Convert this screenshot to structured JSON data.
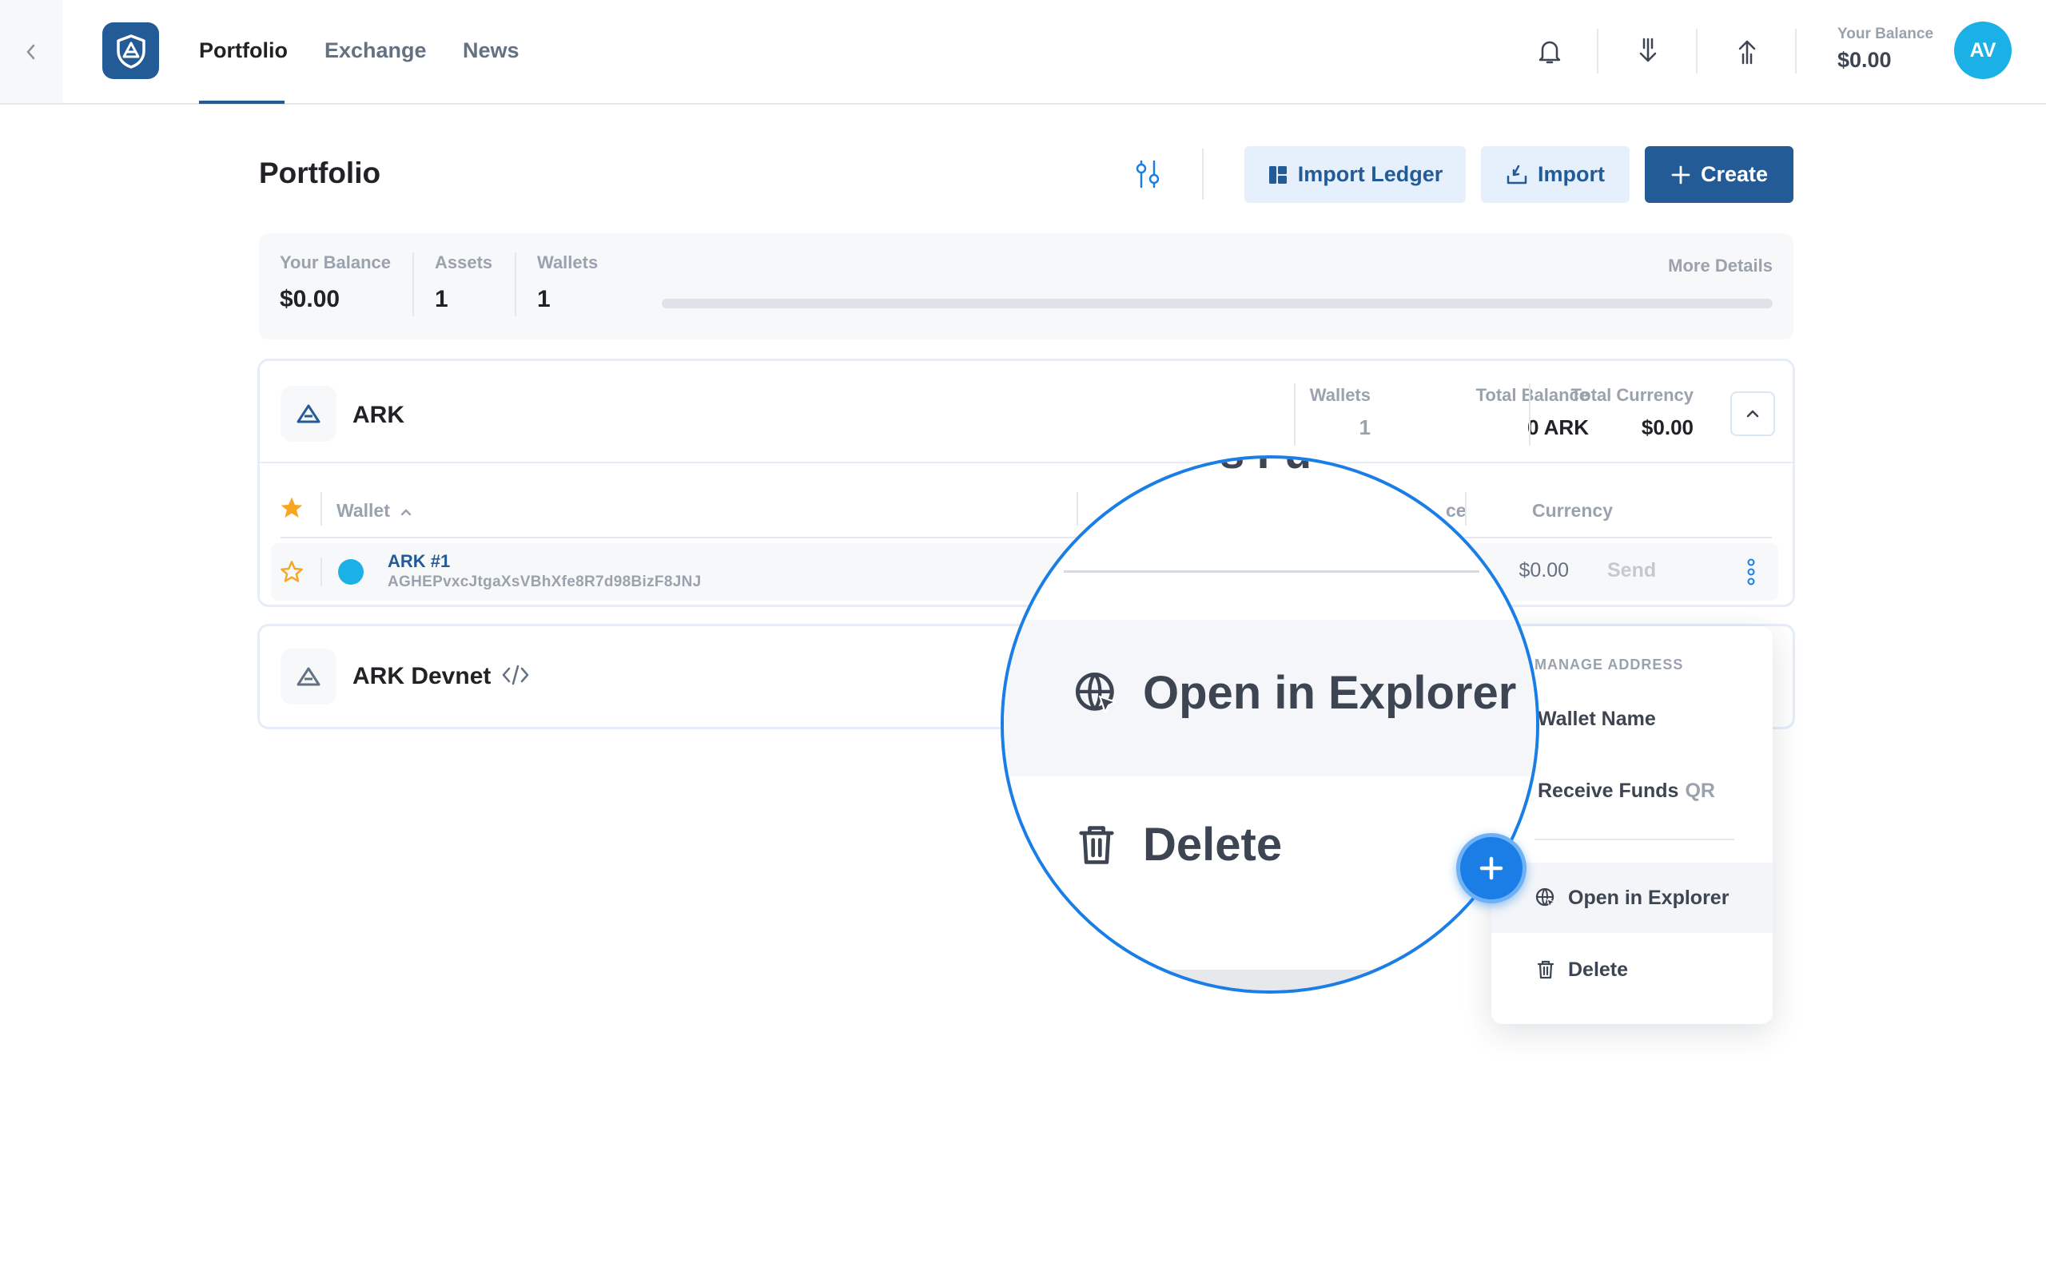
{
  "nav": {
    "tabs": [
      {
        "label": "Portfolio",
        "active": true
      },
      {
        "label": "Exchange",
        "active": false
      },
      {
        "label": "News",
        "active": false
      }
    ],
    "balance_label": "Your Balance",
    "balance_value": "$0.00",
    "avatar_initials": "AV",
    "icons": [
      "chevron-left-icon",
      "notification-bell-icon",
      "receive-arrow-icon",
      "send-arrow-icon"
    ]
  },
  "page": {
    "title": "Portfolio",
    "buttons": {
      "import_ledger": "Import Ledger",
      "import": "Import",
      "create": "Create"
    }
  },
  "summary": {
    "balance_label": "Your Balance",
    "balance_value": "$0.00",
    "assets_label": "Assets",
    "assets_value": "1",
    "wallets_label": "Wallets",
    "wallets_value": "1",
    "more_details": "More Details"
  },
  "groups": [
    {
      "name": "ARK",
      "wallets_label": "Wallets",
      "wallets_value": "1",
      "total_balance_label": "Total Balance",
      "total_balance_value": "0 ARK",
      "total_currency_label": "Total Currency",
      "total_currency_value": "$0.00",
      "table": {
        "col_wallet": "Wallet",
        "col_balance_partial": "ce",
        "col_currency": "Currency"
      },
      "wallets": [
        {
          "name": "ARK #1",
          "address": "AGHEPvxcJtgaXsVBhXfe8R7d98BizF8JNJ",
          "currency": "$0.00",
          "action": "Send"
        }
      ]
    },
    {
      "name": "ARK Devnet"
    }
  ],
  "dropdown": {
    "heading": "MANAGE ADDRESS",
    "wallet_name": "Wallet Name",
    "receive_funds": "Receive Funds",
    "receive_funds_suffix": "QR",
    "open_in_explorer": "Open in Explorer",
    "delete": "Delete"
  },
  "magnifier": {
    "top_partial": "s Fu",
    "open_in_explorer": "Open in Explorer",
    "delete": "Delete"
  },
  "colors": {
    "brand": "#235b97",
    "accent_blue": "#1a7ee6",
    "star": "#f6a623",
    "wallet_dot": "#1bb0e6",
    "muted": "#9aa2ad"
  }
}
